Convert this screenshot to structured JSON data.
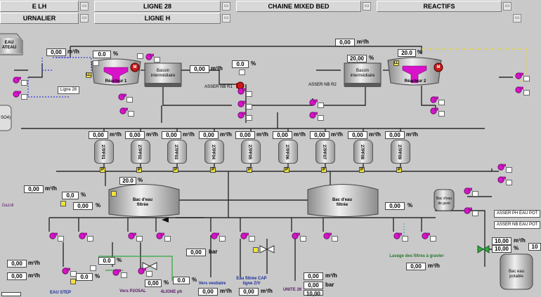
{
  "nav": {
    "row1": [
      "E LH",
      "LIGNE 28",
      "CHAINE MIXED BED",
      "REACTIFS"
    ],
    "row2": [
      "URNALIER",
      "LIGNE H"
    ],
    "btn_glyph": "▭"
  },
  "left_edge": {
    "tank_top": "EAU\nATEAU",
    "so4": "SO4)"
  },
  "top": {
    "flow_main": "0,00",
    "flow_main_unit": "m³/h"
  },
  "reactor1": {
    "label": "Réacteur 1",
    "flow": "0,00",
    "flow_unit": "m³/h",
    "pct": "0.0",
    "pct_unit": "%",
    "motor": "M",
    "line_label": "Ligne 28",
    "ll": "LL"
  },
  "bassin1": {
    "label": "Bassin\nintermédiaire",
    "flow": "0,00",
    "flow_unit": "m³/h",
    "pct": "0.0",
    "pct_unit": "%"
  },
  "asser1": "ASSER NB R1",
  "asser2": "ASSER NB R2",
  "bassin2": {
    "label": "Bassin\nintermédiaire",
    "flow": "20,00",
    "flow_unit": "%"
  },
  "reactor2": {
    "label": "Réacteur 2",
    "pct": "20.0",
    "pct_unit": "%",
    "motor": "M",
    "ll": "LL"
  },
  "filters": {
    "flows": [
      "0,00",
      "0,00",
      "0,00",
      "0,00",
      "0,00",
      "0,00",
      "0,00",
      "0,00",
      "0,00"
    ],
    "unit": "m³/h",
    "names": [
      "27PF01",
      "27PF02",
      "27PF03",
      "27PF04",
      "27PF05",
      "27PF06",
      "27PF07",
      "27PF08",
      "27PF09"
    ],
    "p": "P"
  },
  "bac1": {
    "label": "Bac d'eau\nfiltrée",
    "pct_top": "20.0",
    "pct_unit": "%",
    "pct_mid": "0,0",
    "pct_bot": "0,00"
  },
  "bac2": {
    "label": "Bac d'eau\nfiltrée",
    "pct": "0,00",
    "pct_unit": "%"
  },
  "gazoil": {
    "label": "Gazoil",
    "flow": "0,00",
    "flow_unit": "m³/h"
  },
  "javel": {
    "label": "Bac d'eau\nde javel"
  },
  "asser_ph": "ASSER PH EAU POT",
  "asser_nb": "ASSER NB EAU POT",
  "potable": {
    "label": "Bac eau\npotable",
    "v1": "10,00",
    "v1_unit": "m³/h",
    "v2": "10,00",
    "v2_unit": "%",
    "v3": "10"
  },
  "lavage": {
    "label": "Lavage des filtres à gravier",
    "flow": "0,00",
    "flow_unit": "m³/h"
  },
  "bar1": {
    "value": "0,00",
    "unit": "bar"
  },
  "vestiaire": {
    "label": "Vers vestiaire",
    "flow": "0,00",
    "flow_unit": "m³/h"
  },
  "cap": {
    "label": "Eau filtrée CAP\nligne Z/V",
    "flow": "0,00",
    "flow_unit": "m³/h"
  },
  "unite26": {
    "label": "UNITE 26",
    "v1": "0,00",
    "v1_unit": "m³/h",
    "v2": "0,00",
    "v2_unit": "bar",
    "v3": "10,00"
  },
  "bottom_left": {
    "flow1": "0,00",
    "flow1_unit": "m³/h",
    "flow2": "0,00",
    "flow2_unit": "m³/h",
    "eau_step": "EAU STEP"
  },
  "p205": {
    "label": "Vers P2O5AL",
    "pct1": "0.0",
    "pct2": "0.0",
    "pct_unit": "%"
  },
  "ligne4": {
    "label": "4LIGNE ph",
    "pct": "0.0",
    "pct_unit": "%",
    "small": "0,00"
  },
  "mid_vals": {
    "flow": "0,00",
    "flow_unit": "m³/h"
  },
  "colors": {
    "pump": "#d813c9",
    "pipe": "#2a2a2a",
    "dash_blue": "#3a3fd8",
    "dash_yellow": "#e0d23a",
    "valve_green": "#2fa83e"
  }
}
